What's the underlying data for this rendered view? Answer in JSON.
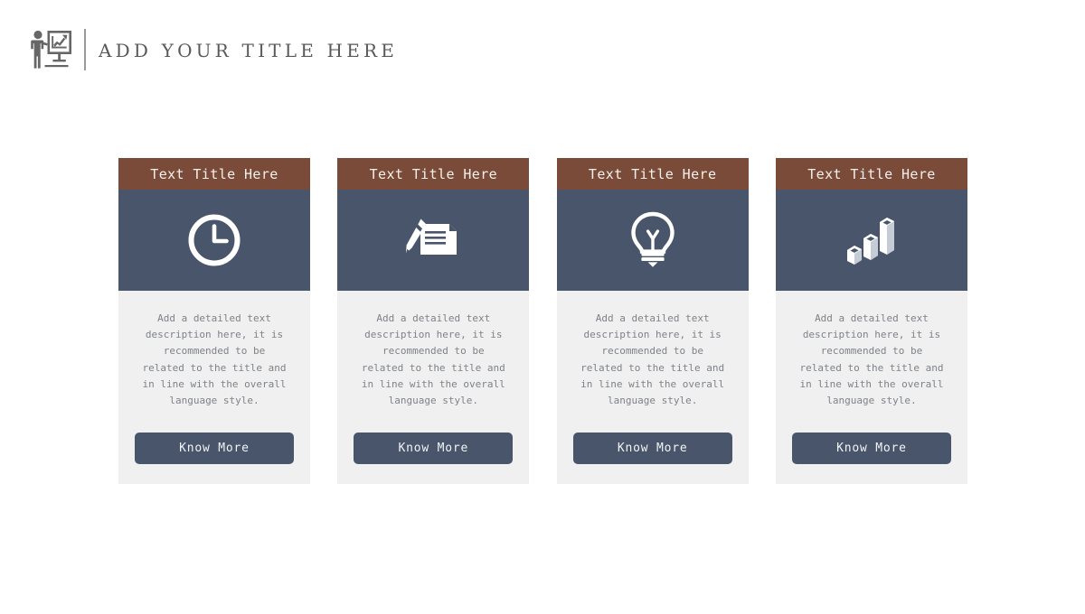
{
  "header": {
    "logo_icon": "presenter-chart-icon",
    "title": "ADD YOUR TITLE HERE",
    "divider": "header-divider",
    "logo_color": "#666666",
    "title_color": "#595959"
  },
  "theme": {
    "band_brown": "#7b4b39",
    "band_slate": "#48556a",
    "card_body": "#f0f0f0",
    "button_bg": "#48556a",
    "button_text": "#f2f4f7",
    "desc_text": "#7e8288",
    "page_bg": "#ffffff"
  },
  "cards": [
    {
      "title": "Text Title Here",
      "icon": "clock-icon",
      "description": "Add a detailed text description here, it is recommended to be related to the title and in line with the overall language style.",
      "button_label": "Know More"
    },
    {
      "title": "Text Title Here",
      "icon": "pen-document-icon",
      "description": "Add a detailed text description here, it is recommended to be related to the title and in line with the overall language style.",
      "button_label": "Know More"
    },
    {
      "title": "Text Title Here",
      "icon": "lightbulb-icon",
      "description": "Add a detailed text description here, it is recommended to be related to the title and in line with the overall language style.",
      "button_label": "Know More"
    },
    {
      "title": "Text Title Here",
      "icon": "bar-chart-3d-icon",
      "description": "Add a detailed text description here, it is recommended to be related to the title and in line with the overall language style.",
      "button_label": "Know More"
    }
  ]
}
